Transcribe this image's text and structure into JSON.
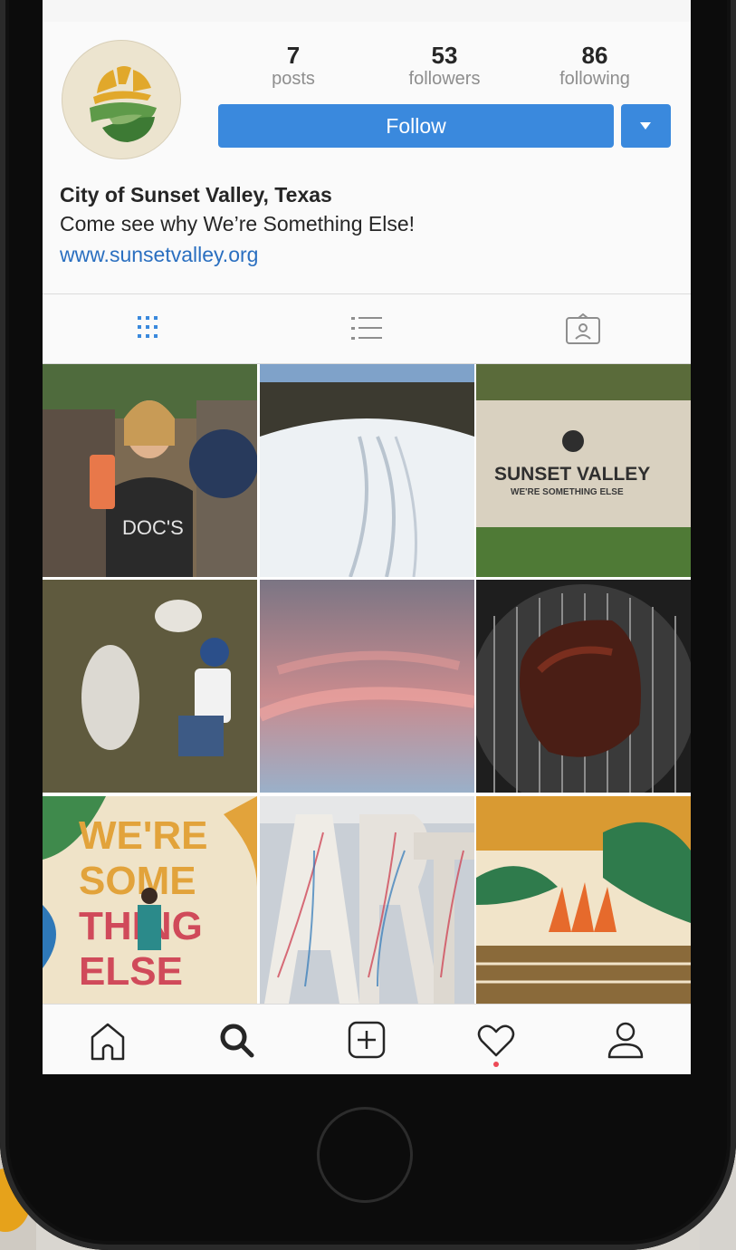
{
  "profile": {
    "stats": {
      "posts_count": "7",
      "posts_label": "posts",
      "followers_count": "53",
      "followers_label": "followers",
      "following_count": "86",
      "following_label": "following"
    },
    "follow_label": "Follow",
    "name": "City of Sunset Valley, Texas",
    "bio": "Come see why We’re Something Else!",
    "website": "www.sunsetvalley.org"
  },
  "tabs": [
    "grid-view",
    "list-view",
    "tagged-photos"
  ],
  "grid": {
    "items": [
      {
        "subject": "woman with drink can"
      },
      {
        "subject": "snowy road"
      },
      {
        "subject": "Sunset Valley sign",
        "sign_title": "SUNSET VALLEY",
        "sign_tagline": "WE'RE SOMETHING ELSE"
      },
      {
        "subject": "child with goats"
      },
      {
        "subject": "pink sunset clouds"
      },
      {
        "subject": "brisket on grill"
      },
      {
        "subject": "We're Something Else mural"
      },
      {
        "subject": "ART letters sculpture"
      },
      {
        "subject": "vegetables illustration"
      }
    ]
  },
  "bottom_nav": [
    "home",
    "search",
    "new-post",
    "activity",
    "profile"
  ],
  "colors": {
    "accent": "#3a89dd",
    "link": "#2a6fc0",
    "notification_dot": "#ed4956"
  }
}
